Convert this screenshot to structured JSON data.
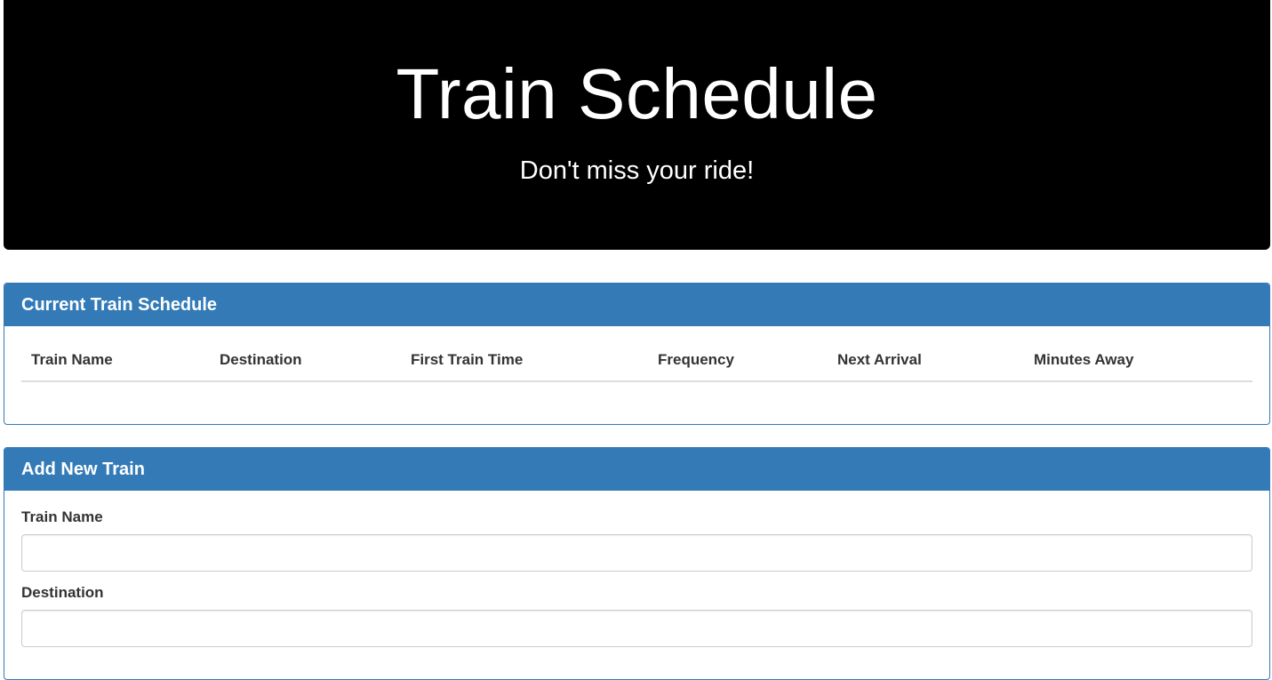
{
  "header": {
    "title": "Train Schedule",
    "subtitle": "Don't miss your ride!"
  },
  "schedule_panel": {
    "heading": "Current Train Schedule",
    "columns": [
      "Train Name",
      "Destination",
      "First Train Time",
      "Frequency",
      "Next Arrival",
      "Minutes Away"
    ]
  },
  "add_panel": {
    "heading": "Add New Train",
    "fields": [
      {
        "label": "Train Name",
        "value": "",
        "placeholder": ""
      },
      {
        "label": "Destination",
        "value": "",
        "placeholder": ""
      }
    ]
  },
  "colors": {
    "panel_primary": "#337ab7",
    "jumbotron_bg": "#000000"
  }
}
